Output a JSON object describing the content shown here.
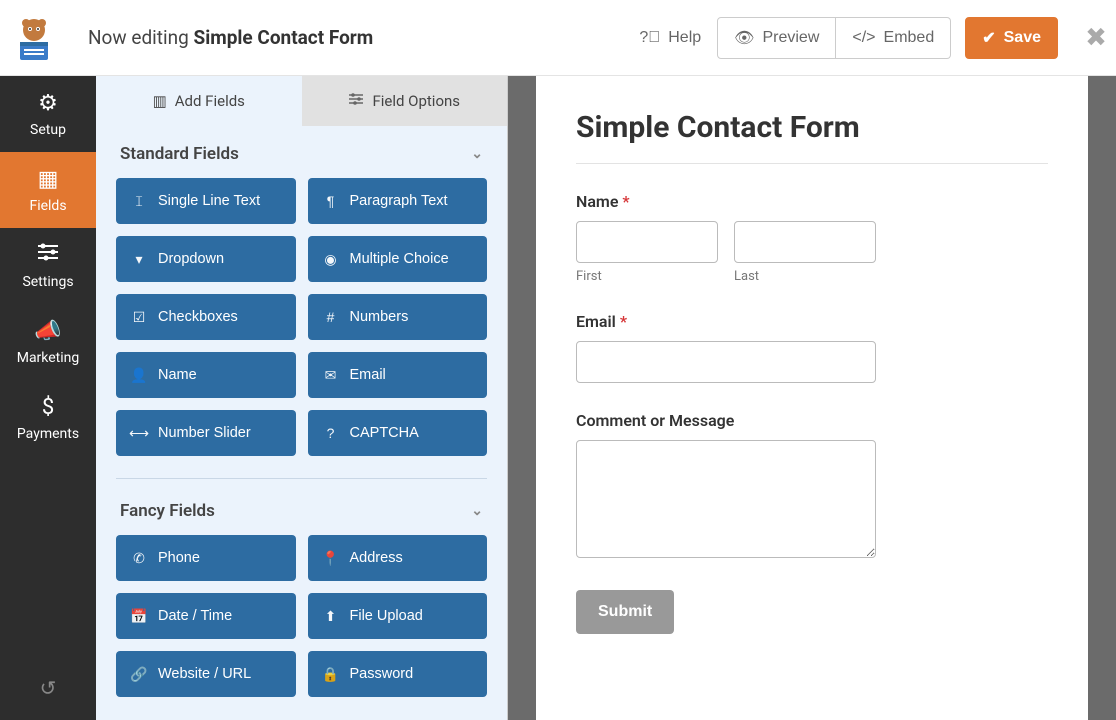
{
  "topbar": {
    "editing_prefix": "Now editing",
    "form_name": "Simple Contact Form",
    "help": "Help",
    "preview": "Preview",
    "embed": "Embed",
    "save": "Save"
  },
  "nav": {
    "setup": "Setup",
    "fields": "Fields",
    "settings": "Settings",
    "marketing": "Marketing",
    "payments": "Payments"
  },
  "panel": {
    "tab_add": "Add Fields",
    "tab_options": "Field Options",
    "standard_header": "Standard Fields",
    "fancy_header": "Fancy Fields",
    "standard": [
      {
        "label": "Single Line Text",
        "icon": "𝙸"
      },
      {
        "label": "Paragraph Text",
        "icon": "¶"
      },
      {
        "label": "Dropdown",
        "icon": "▾"
      },
      {
        "label": "Multiple Choice",
        "icon": "◉"
      },
      {
        "label": "Checkboxes",
        "icon": "☑"
      },
      {
        "label": "Numbers",
        "icon": "#"
      },
      {
        "label": "Name",
        "icon": "👤"
      },
      {
        "label": "Email",
        "icon": "✉"
      },
      {
        "label": "Number Slider",
        "icon": "⟷"
      },
      {
        "label": "CAPTCHA",
        "icon": "?"
      }
    ],
    "fancy": [
      {
        "label": "Phone",
        "icon": "✆"
      },
      {
        "label": "Address",
        "icon": "📍"
      },
      {
        "label": "Date / Time",
        "icon": "📅"
      },
      {
        "label": "File Upload",
        "icon": "⬆"
      },
      {
        "label": "Website / URL",
        "icon": "🔗"
      },
      {
        "label": "Password",
        "icon": "🔒"
      }
    ]
  },
  "form": {
    "title": "Simple Contact Form",
    "name_label": "Name",
    "first_sub": "First",
    "last_sub": "Last",
    "email_label": "Email",
    "message_label": "Comment or Message",
    "submit": "Submit"
  }
}
